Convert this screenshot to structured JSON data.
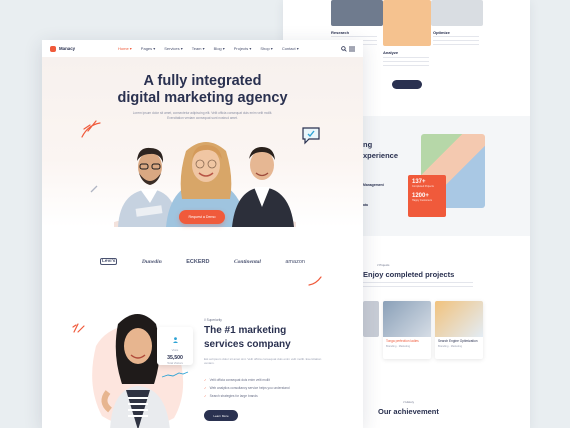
{
  "brand": {
    "name": "Manacy",
    "accent": "#f05a3b",
    "navy": "#2a3150"
  },
  "nav": {
    "items": [
      "Home ▾",
      "Pages ▾",
      "Services ▾",
      "Team ▾",
      "Blog ▾",
      "Projects ▾",
      "Shop ▾",
      "Contact ▾"
    ]
  },
  "hero": {
    "title_line1": "A fully integrated",
    "title_line2": "digital marketing agency",
    "subtitle": "Lorem ipsum dolor sit amet, consectetur adipiscing elit. Velit officia consequat duis enim velit mollit. Exercitation veniam consequat sunt nostrud amet.",
    "button": "Request a Demo"
  },
  "brands": [
    "Levi's",
    "Dunedin",
    "ECKERD",
    "Continental",
    "amazon"
  ],
  "company": {
    "eyebrow": "// Superiority",
    "title_line1": "The #1 marketing",
    "title_line2": "services company",
    "body": "Est ad ipsum dolor sit amet sint. Velit officia consequat duis enim velit mollit. Exercitation veniam.",
    "checks": [
      "Velit officia consequat duis enim velit mollit",
      "Web analytics consultancy service helps you understand",
      "Search strategies for large brands"
    ],
    "button": "Learn More",
    "stat_label": "Visits",
    "stat_value": "35,500",
    "stat_caption": "Total Visitors"
  },
  "back": {
    "items": [
      "Research",
      "Analyze",
      "Optimize"
    ],
    "experience_title_1": "ng",
    "experience_title_2": "xperience",
    "exp_items": [
      "Management",
      "ata"
    ],
    "stats": [
      "137+",
      "1200+"
    ],
    "stat_labels": [
      "Completed Projects",
      "Happy Customers"
    ],
    "projects_eyebrow": "// Projects",
    "projects_title": "Enjoy completed projects",
    "project_cards": [
      {
        "title": "Tonga perfection ladies",
        "meta": "Branding · Marketing"
      },
      {
        "title": "Search Engine Optimization",
        "meta": "Branding · Marketing"
      }
    ],
    "achievement_eyebrow": "// History",
    "achievement_title": "Our achievement"
  }
}
